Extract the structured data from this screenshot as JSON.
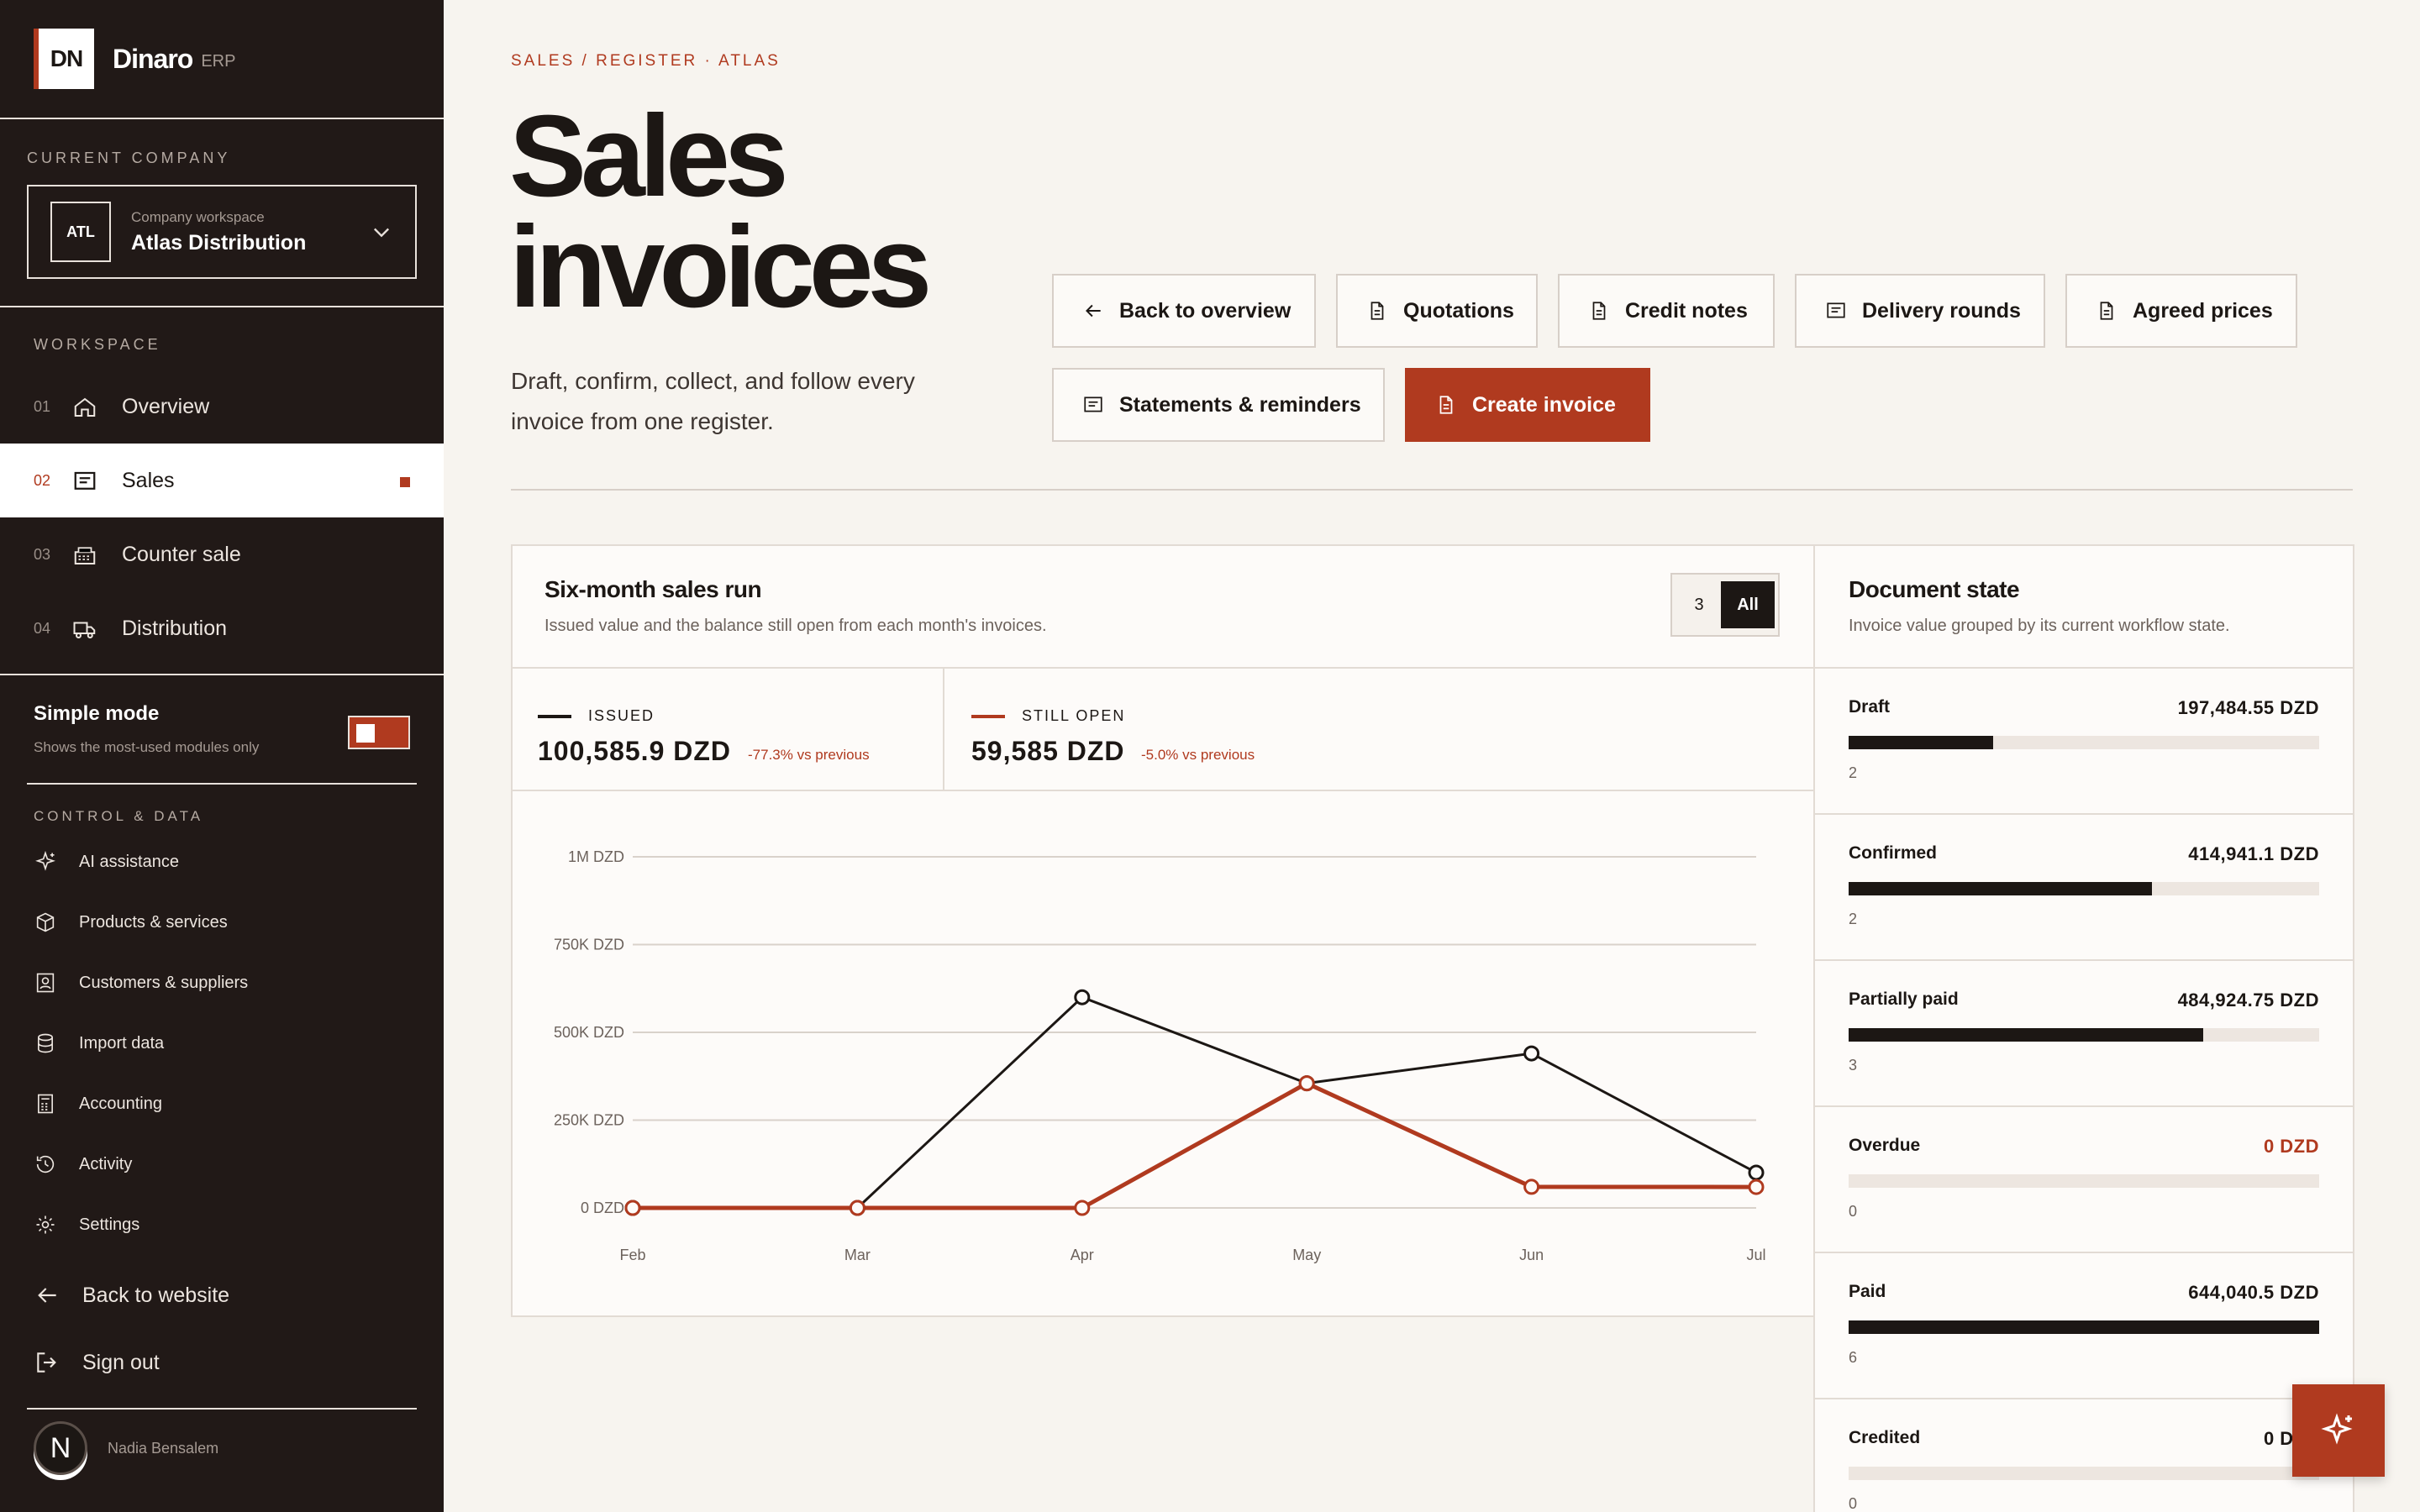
{
  "brand": {
    "logo": "DN",
    "name": "Dinaro",
    "suffix": "ERP"
  },
  "company": {
    "section_label": "CURRENT COMPANY",
    "badge": "ATL",
    "caption": "Company workspace",
    "name": "Atlas Distribution"
  },
  "workspace": {
    "section_label": "WORKSPACE",
    "items": [
      {
        "num": "01",
        "label": "Overview",
        "icon": "home-icon"
      },
      {
        "num": "02",
        "label": "Sales",
        "icon": "receipt-icon",
        "active": true
      },
      {
        "num": "03",
        "label": "Counter sale",
        "icon": "register-icon"
      },
      {
        "num": "04",
        "label": "Distribution",
        "icon": "truck-icon"
      }
    ]
  },
  "simple_mode": {
    "title": "Simple mode",
    "subtitle": "Shows the most-used modules only",
    "enabled": true
  },
  "control": {
    "section_label": "CONTROL & DATA",
    "items": [
      {
        "label": "AI assistance",
        "icon": "sparkle-icon"
      },
      {
        "label": "Products & services",
        "icon": "box-icon"
      },
      {
        "label": "Customers & suppliers",
        "icon": "contact-icon"
      },
      {
        "label": "Import data",
        "icon": "database-icon"
      },
      {
        "label": "Accounting",
        "icon": "calculator-icon"
      },
      {
        "label": "Activity",
        "icon": "history-icon"
      },
      {
        "label": "Settings",
        "icon": "gear-icon"
      }
    ]
  },
  "bottom": {
    "back": "Back to website",
    "signout": "Sign out"
  },
  "user": {
    "initial": "N",
    "name": "Nadia Bensalem"
  },
  "header": {
    "breadcrumb": "SALES / REGISTER · ATLAS",
    "title_line1": "Sales",
    "title_line2": "invoices",
    "description": "Draft, confirm, collect, and follow every invoice from one register."
  },
  "actions": {
    "back": "Back to overview",
    "quotations": "Quotations",
    "credit_notes": "Credit notes",
    "delivery_rounds": "Delivery rounds",
    "agreed_prices": "Agreed prices",
    "statements": "Statements & reminders",
    "create": "Create invoice"
  },
  "sales_panel": {
    "title": "Six-month sales run",
    "subtitle": "Issued value and the balance still open from each month's invoices.",
    "range_options": [
      "3",
      "All"
    ],
    "range_selected": "All",
    "kpis": [
      {
        "label": "ISSUED",
        "value": "100,585.9 DZD",
        "delta": "-77.3% vs previous",
        "color": "#1c1714"
      },
      {
        "label": "STILL OPEN",
        "value": "59,585 DZD",
        "delta": "-5.0% vs previous",
        "color": "#b03a1f"
      }
    ]
  },
  "chart_data": {
    "type": "line",
    "x": [
      "Feb",
      "Mar",
      "Apr",
      "May",
      "Jun",
      "Jul"
    ],
    "series": [
      {
        "name": "Issued",
        "color": "#1c1714",
        "values": [
          0,
          0,
          600000,
          355000,
          440000,
          100586
        ]
      },
      {
        "name": "Still open",
        "color": "#b03a1f",
        "values": [
          0,
          0,
          0,
          355000,
          60000,
          59585
        ]
      }
    ],
    "yticks": [
      0,
      250000,
      500000,
      750000,
      1000000
    ],
    "ytick_labels": [
      "0 DZD",
      "250K DZD",
      "500K DZD",
      "750K DZD",
      "1M DZD"
    ],
    "ylim": [
      0,
      1000000
    ],
    "grid": true
  },
  "document_state": {
    "title": "Document state",
    "subtitle": "Invoice value grouped by its current workflow state.",
    "rows": [
      {
        "name": "Draft",
        "amount": "197,484.55 DZD",
        "count": "2",
        "fraction": 0.307
      },
      {
        "name": "Confirmed",
        "amount": "414,941.1 DZD",
        "count": "2",
        "fraction": 0.644
      },
      {
        "name": "Partially paid",
        "amount": "484,924.75 DZD",
        "count": "3",
        "fraction": 0.753
      },
      {
        "name": "Overdue",
        "amount": "0 DZD",
        "count": "0",
        "fraction": 0,
        "accent": true
      },
      {
        "name": "Paid",
        "amount": "644,040.5 DZD",
        "count": "6",
        "fraction": 1.0
      },
      {
        "name": "Credited",
        "amount": "0 DZD",
        "count": "0",
        "fraction": 0
      }
    ]
  }
}
